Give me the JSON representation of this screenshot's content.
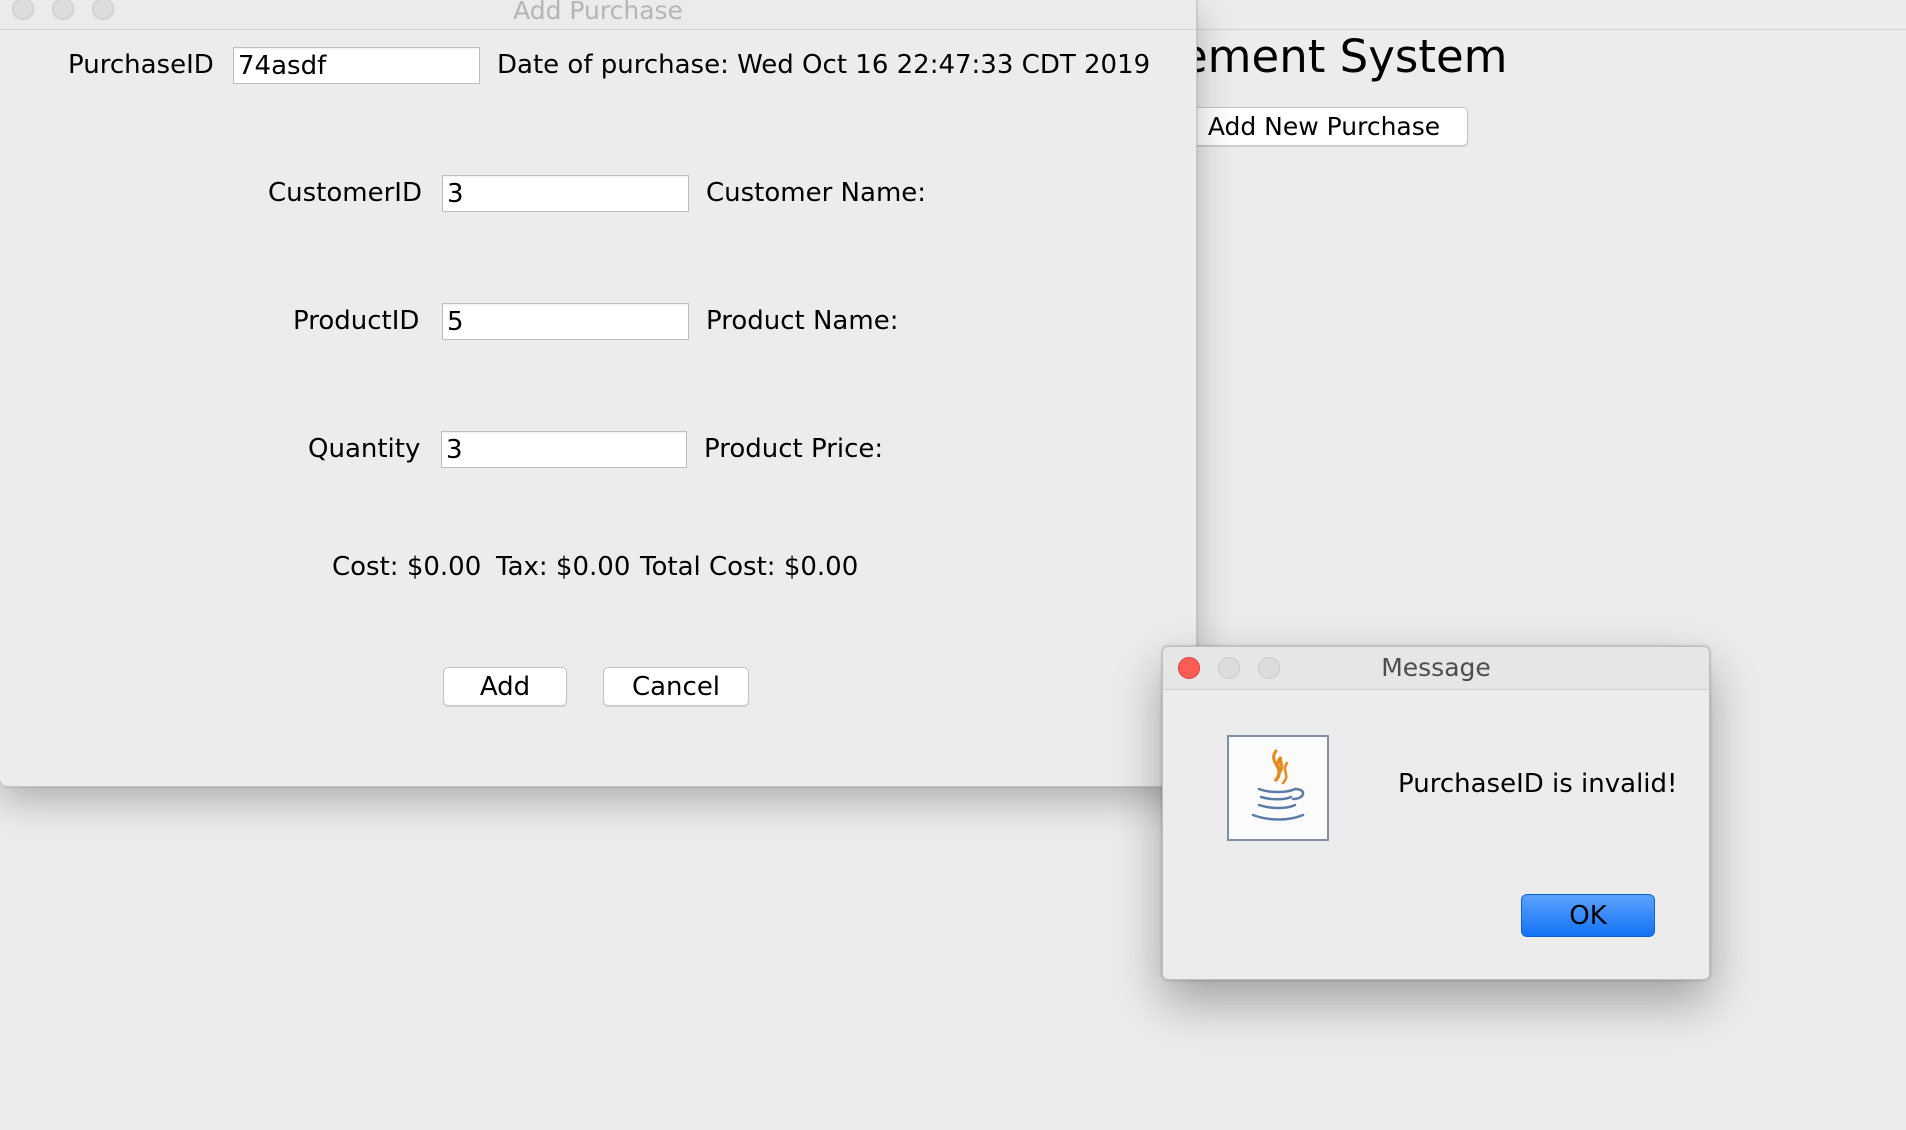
{
  "main_window": {
    "title_fragment": "ement System",
    "add_new_purchase_label": "Add New Purchase"
  },
  "add_purchase": {
    "window_title": "Add Purchase",
    "purchase_id_label": "PurchaseID",
    "purchase_id_value": "74asdf",
    "date_label": "Date of purchase: Wed Oct 16 22:47:33 CDT 2019",
    "customer_id_label": "CustomerID",
    "customer_id_value": "3",
    "customer_name_label": "Customer Name:",
    "product_id_label": "ProductID",
    "product_id_value": "5",
    "product_name_label": "Product Name:",
    "quantity_label": "Quantity",
    "quantity_value": "3",
    "product_price_label": "Product Price:",
    "cost_text": "Cost: $0.00",
    "tax_text": "Tax: $0.00",
    "total_text": "Total Cost: $0.00",
    "add_label": "Add",
    "cancel_label": "Cancel"
  },
  "message_dialog": {
    "title": "Message",
    "icon": "java-icon",
    "text": "PurchaseID is invalid!",
    "ok_label": "OK"
  },
  "colors": {
    "window_bg": "#ececec",
    "ok_button": "#1273f5",
    "close_button": "#fc5c56"
  }
}
